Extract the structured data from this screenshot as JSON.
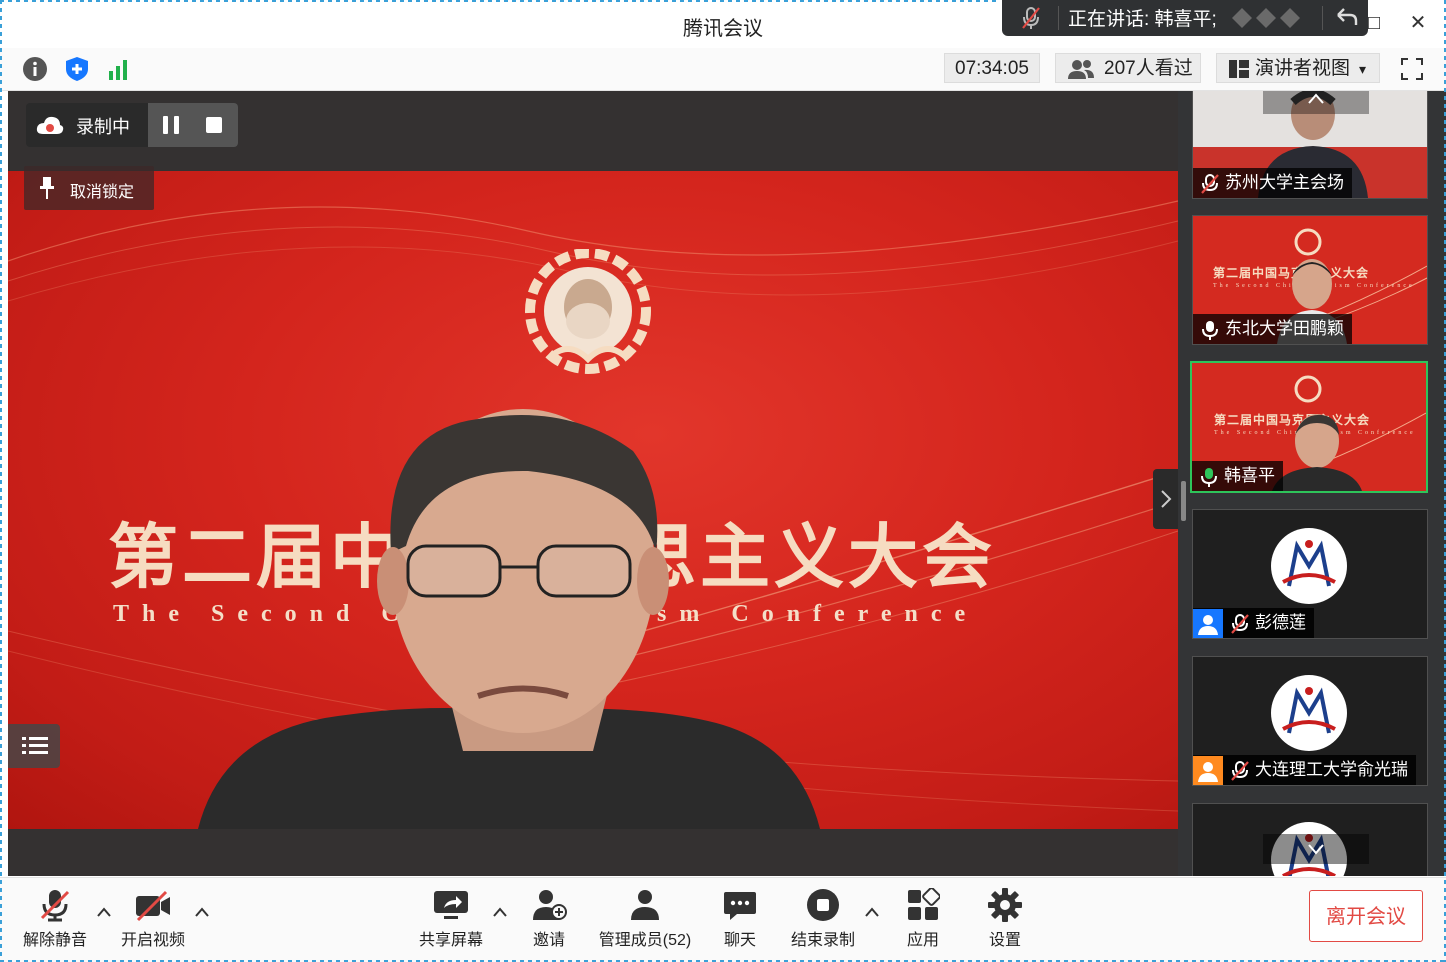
{
  "window": {
    "title": "腾讯会议",
    "maximize_glyph": "□",
    "close_glyph": "✕"
  },
  "speaking": {
    "text": "正在讲话: 韩喜平;"
  },
  "infobar": {
    "icons": [
      "info-icon",
      "shield-icon",
      "signal-icon"
    ],
    "time": "07:34:05",
    "viewers": "207人看过",
    "view_mode": "演讲者视图",
    "view_caret": "▾"
  },
  "stage": {
    "recording_label": "录制中",
    "unpin_label": "取消锁定",
    "slide_title": "第二届中国马克思主义大会",
    "slide_subtitle": "The Second China Marxism Conference",
    "tile_slide_title": "第二届中国马克思主义大会",
    "tile_slide_subtitle": "The Second China Marxism Conference"
  },
  "participants": [
    {
      "name": "苏州大学主会场",
      "mic": "muted"
    },
    {
      "name": "东北大学田鹏颖",
      "mic": "on"
    },
    {
      "name": "韩喜平",
      "mic": "on",
      "active": true
    },
    {
      "name": "彭德莲",
      "mic": "muted",
      "badge": "#1677ff"
    },
    {
      "name": "大连理工大学俞光瑞",
      "mic": "muted",
      "badge": "#ff8a1f"
    }
  ],
  "toolbar": {
    "unmute": "解除静音",
    "start_video": "开启视频",
    "share_screen": "共享屏幕",
    "invite": "邀请",
    "manage_members": "管理成员(52)",
    "chat": "聊天",
    "end_recording": "结束录制",
    "apps": "应用",
    "settings": "设置",
    "leave": "离开会议"
  },
  "colors": {
    "accent_red": "#e24a44",
    "active_border": "#2ec45a",
    "slide_red": "#d4251d",
    "slide_gold": "#f6dcc1"
  }
}
